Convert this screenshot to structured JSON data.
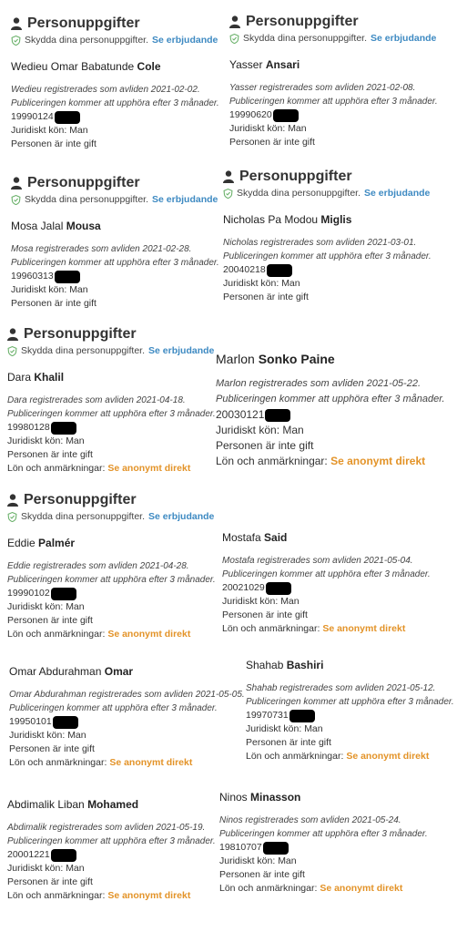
{
  "section_title": "Personuppgifter",
  "protect_text": "Skydda dina personuppgifter.",
  "protect_link": "Se erbjudande",
  "salary_label": "Lön och anmärkningar:",
  "salary_link": "Se anonymt direkt",
  "icons": {
    "header": "person-icon",
    "protect": "shield-icon"
  },
  "colors": {
    "link_blue": "#3e8ac2",
    "link_orange": "#e39328",
    "redaction": "#000000"
  },
  "cards": [
    {
      "first": "Wedieu Omar Babatunde",
      "last": "Cole",
      "deceased": "Wedieu registrerades som avliden 2021-02-02.",
      "publishing": "Publiceringen kommer att upphöra efter 3 månader.",
      "pnr": "19990124",
      "gender": "Juridiskt kön: Man",
      "married": "Personen är inte gift"
    },
    {
      "first": "Yasser",
      "last": "Ansari",
      "deceased": "Yasser registrerades som avliden 2021-02-08.",
      "publishing": "Publiceringen kommer att upphöra efter 3 månader.",
      "pnr": "19990620",
      "gender": "Juridiskt kön: Man",
      "married": "Personen är inte gift"
    },
    {
      "first": "Mosa Jalal",
      "last": "Mousa",
      "deceased": "Mosa registrerades som avliden 2021-02-28.",
      "publishing": "Publiceringen kommer att upphöra efter 3 månader.",
      "pnr": "19960313",
      "gender": "Juridiskt kön: Man",
      "married": "Personen är inte gift"
    },
    {
      "first": "Nicholas Pa Modou",
      "last": "Miglis",
      "deceased": "Nicholas registrerades som avliden 2021-03-01.",
      "publishing": "Publiceringen kommer att upphöra efter 3 månader.",
      "pnr": "20040218",
      "gender": "Juridiskt kön: Man",
      "married": "Personen är inte gift"
    },
    {
      "first": "Dara",
      "last": "Khalil",
      "deceased": "Dara registrerades som avliden 2021-04-18.",
      "publishing": "Publiceringen kommer att upphöra efter 3 månader.",
      "pnr": "19980128",
      "gender": "Juridiskt kön: Man",
      "married": "Personen är inte gift"
    },
    {
      "first": "Marlon",
      "last": "Sonko Paine",
      "deceased": "Marlon registrerades som avliden 2021-05-22.",
      "publishing": "Publiceringen kommer att upphöra efter 3 månader.",
      "pnr": "20030121",
      "gender": "Juridiskt kön: Man",
      "married": "Personen är inte gift"
    },
    {
      "first": "Eddie",
      "last": "Palmér",
      "deceased": "Eddie registrerades som avliden 2021-04-28.",
      "publishing": "Publiceringen kommer att upphöra efter 3 månader.",
      "pnr": "19990102",
      "gender": "Juridiskt kön: Man",
      "married": "Personen är inte gift"
    },
    {
      "first": "Mostafa",
      "last": "Said",
      "deceased": "Mostafa registrerades som avliden 2021-05-04.",
      "publishing": "Publiceringen kommer att upphöra efter 3 månader.",
      "pnr": "20021029",
      "gender": "Juridiskt kön: Man",
      "married": "Personen är inte gift"
    },
    {
      "first": "Omar Abdurahman",
      "last": "Omar",
      "deceased": "Omar Abdurahman registrerades som avliden 2021-05-05.",
      "publishing": "Publiceringen kommer att upphöra efter 3 månader.",
      "pnr": "19950101",
      "gender": "Juridiskt kön: Man",
      "married": "Personen är inte gift"
    },
    {
      "first": "Shahab",
      "last": "Bashiri",
      "deceased": "Shahab registrerades som avliden 2021-05-12.",
      "publishing": "Publiceringen kommer att upphöra efter 3 månader.",
      "pnr": "19970731",
      "gender": "Juridiskt kön: Man",
      "married": "Personen är inte gift"
    },
    {
      "first": "Abdimalik Liban",
      "last": "Mohamed",
      "deceased": "Abdimalik registrerades som avliden 2021-05-19.",
      "publishing": "Publiceringen kommer att upphöra efter 3 månader.",
      "pnr": "20001221",
      "gender": "Juridiskt kön: Man",
      "married": "Personen är inte gift"
    },
    {
      "first": "Ninos",
      "last": "Minasson",
      "deceased": "Ninos registrerades som avliden 2021-05-24.",
      "publishing": "Publiceringen kommer att upphöra efter 3 månader.",
      "pnr": "19810707",
      "gender": "Juridiskt kön: Man",
      "married": "Personen är inte gift"
    }
  ]
}
